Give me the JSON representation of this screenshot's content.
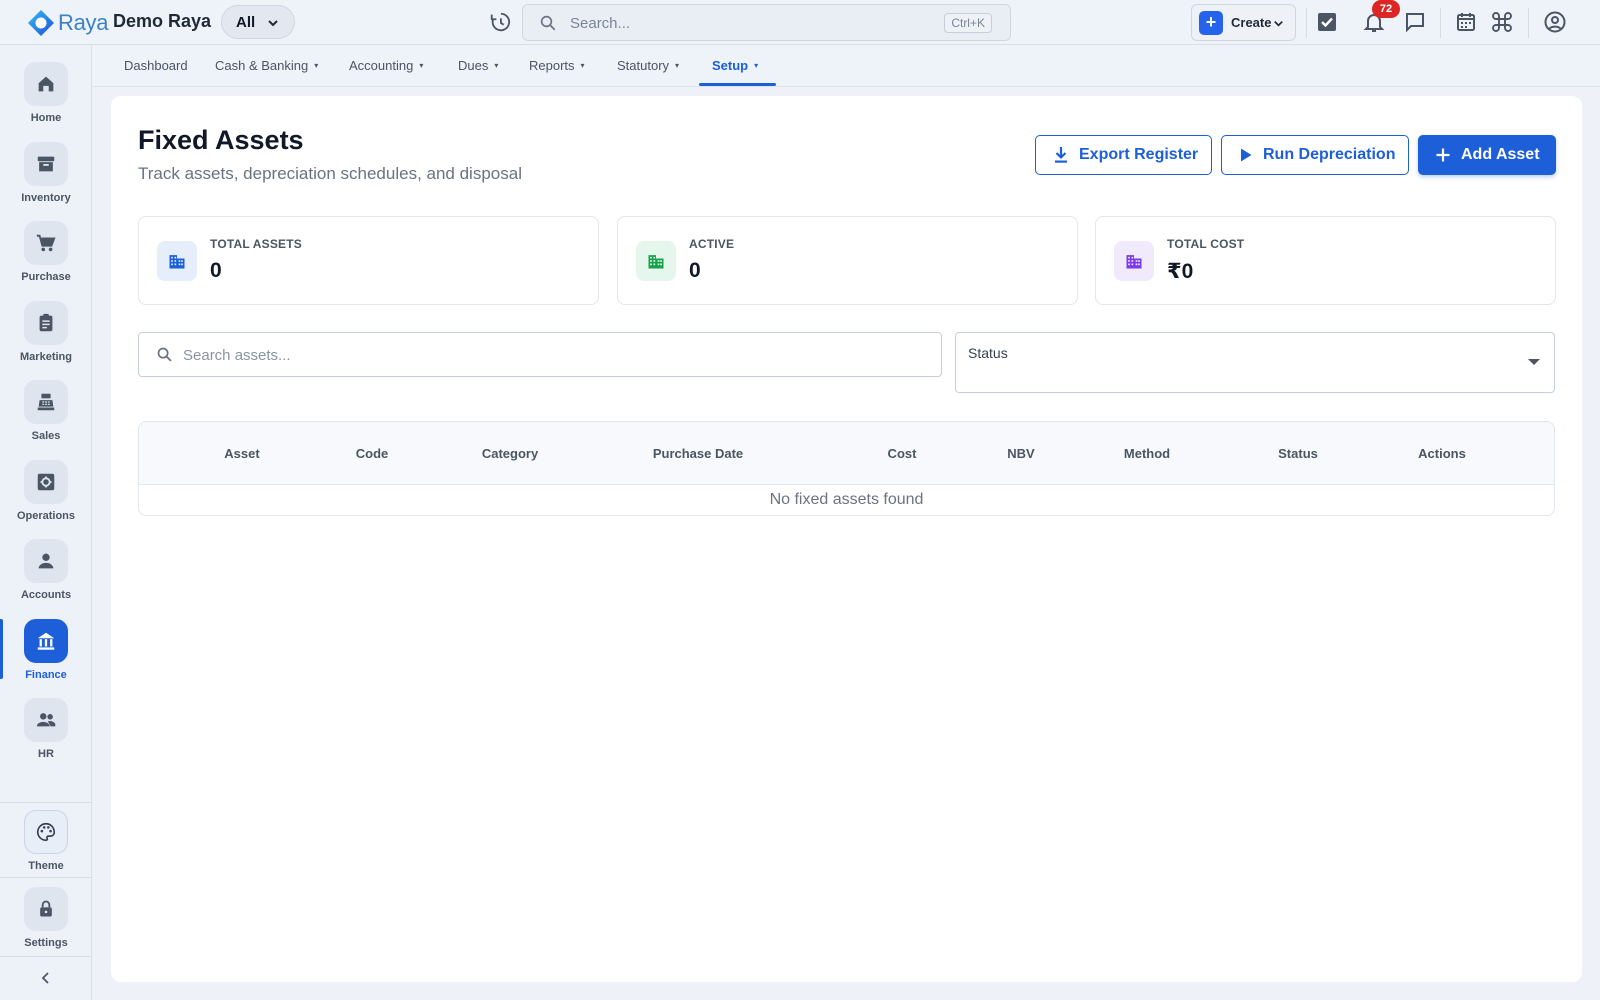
{
  "app": {
    "logo_text": "Raya",
    "company": "Demo Raya",
    "scope_selector": "All",
    "search_placeholder": "Search...",
    "search_shortcut": "Ctrl+K",
    "create_label": "Create",
    "notification_count": "72",
    "accent_color": "#1d5fd8"
  },
  "sidebar": {
    "items": [
      {
        "label": "Home",
        "icon": "home-icon"
      },
      {
        "label": "Inventory",
        "icon": "archive-icon"
      },
      {
        "label": "Purchase",
        "icon": "cart-icon"
      },
      {
        "label": "Marketing",
        "icon": "clipboard-icon"
      },
      {
        "label": "Sales",
        "icon": "cash-register-icon"
      },
      {
        "label": "Operations",
        "icon": "gear-box-icon"
      },
      {
        "label": "Accounts",
        "icon": "person-icon"
      },
      {
        "label": "Finance",
        "icon": "bank-icon",
        "active": true
      },
      {
        "label": "HR",
        "icon": "people-icon"
      }
    ],
    "bottom": [
      {
        "label": "Theme",
        "icon": "palette-icon"
      },
      {
        "label": "Settings",
        "icon": "lock-icon"
      }
    ]
  },
  "subnav": {
    "items": [
      {
        "label": "Dashboard"
      },
      {
        "label": "Cash & Banking",
        "caret": "▾"
      },
      {
        "label": "Accounting",
        "caret": "▾"
      },
      {
        "label": "Dues",
        "caret": "▾"
      },
      {
        "label": "Reports",
        "caret": "▾"
      },
      {
        "label": "Statutory",
        "caret": "▾"
      },
      {
        "label": "Setup",
        "caret": "▾",
        "active": true
      }
    ]
  },
  "page": {
    "title": "Fixed Assets",
    "subtitle": "Track assets, depreciation schedules, and disposal",
    "buttons": {
      "export": "Export Register",
      "run_depreciation": "Run Depreciation",
      "add_asset": "Add Asset"
    },
    "stats": [
      {
        "label": "TOTAL ASSETS",
        "value": "0",
        "color": "#1d5fd8"
      },
      {
        "label": "ACTIVE",
        "value": "0",
        "color": "#16a34a"
      },
      {
        "label": "TOTAL COST",
        "value": "₹0",
        "color": "#7c3aed"
      }
    ],
    "search_placeholder": "Search assets...",
    "status_filter_label": "Status",
    "table": {
      "columns": [
        "Asset",
        "Code",
        "Category",
        "Purchase Date",
        "Cost",
        "NBV",
        "Method",
        "Status",
        "Actions"
      ],
      "empty_message": "No fixed assets found"
    }
  }
}
